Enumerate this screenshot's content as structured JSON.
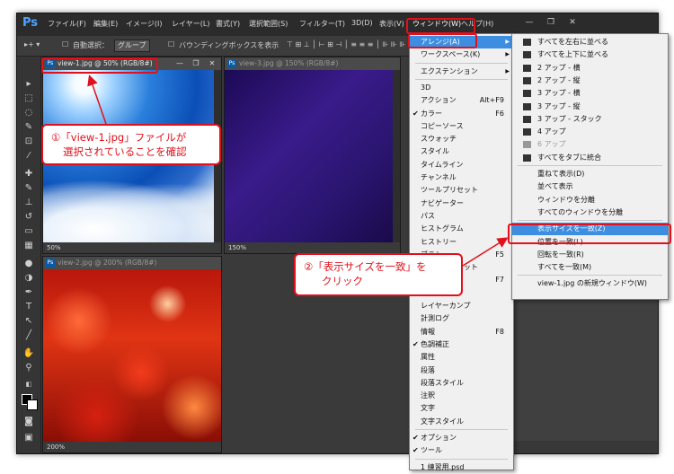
{
  "app": {
    "logo": "Ps",
    "menus": [
      "ファイル(F)",
      "編集(E)",
      "イメージ(I)",
      "レイヤー(L)",
      "書式(Y)",
      "選択範囲(S)",
      "フィルター(T)",
      "3D(D)",
      "表示(V)",
      "ウィンドウ(W)",
      "ヘルプ(H)"
    ],
    "window_controls": [
      "—",
      "❐",
      "✕"
    ]
  },
  "options_bar": {
    "auto_select_label": "自動選択：",
    "auto_select_value": "グループ",
    "bounding_box_label": "バウンディングボックスを表示"
  },
  "documents": [
    {
      "title": "view-1.jpg @ 50% (RGB/8#)",
      "zoom": "50%"
    },
    {
      "title": "view-3.jpg @ 150% (RGB/8#)",
      "zoom": "150%"
    },
    {
      "title": "view-2.jpg @ 200% (RGB/8#)",
      "zoom": "200%"
    }
  ],
  "window_menu": {
    "items": [
      {
        "label": "アレンジ(A)",
        "submenu": true,
        "highlighted": true
      },
      {
        "label": "ワークスペース(K)",
        "submenu": true
      },
      {
        "sep": true
      },
      {
        "label": "エクステンション",
        "submenu": true
      },
      {
        "sep": true
      },
      {
        "label": "3D"
      },
      {
        "label": "アクション",
        "shortcut": "Alt+F9"
      },
      {
        "label": "カラー",
        "shortcut": "F6",
        "checked": true
      },
      {
        "label": "コピーソース"
      },
      {
        "label": "スウォッチ"
      },
      {
        "label": "スタイル"
      },
      {
        "label": "タイムライン"
      },
      {
        "label": "チャンネル"
      },
      {
        "label": "ツールプリセット"
      },
      {
        "label": "ナビゲーター"
      },
      {
        "label": "パス"
      },
      {
        "label": "ヒストグラム"
      },
      {
        "label": "ヒストリー"
      },
      {
        "label": "ブラシ",
        "shortcut": "F5"
      },
      {
        "label": "ブラシプリセット"
      },
      {
        "label": "プロパティ",
        "shortcut": "F7"
      },
      {
        "label": "レイヤー"
      },
      {
        "label": "レイヤーカンプ"
      },
      {
        "label": "計測ログ"
      },
      {
        "label": "情報",
        "shortcut": "F8"
      },
      {
        "label": "色調補正",
        "checked": true
      },
      {
        "label": "属性"
      },
      {
        "label": "段落"
      },
      {
        "label": "段落スタイル"
      },
      {
        "label": "注釈"
      },
      {
        "label": "文字"
      },
      {
        "label": "文字スタイル"
      },
      {
        "sep": true
      },
      {
        "label": "オプション",
        "checked": true
      },
      {
        "label": "ツール",
        "checked": true
      },
      {
        "sep": true
      },
      {
        "label": "1 練習用.psd"
      }
    ]
  },
  "arrange_submenu": {
    "items": [
      {
        "label": "すべてを左右に並べる",
        "icon": true
      },
      {
        "label": "すべてを上下に並べる",
        "icon": true
      },
      {
        "label": "2 アップ - 横",
        "icon": true
      },
      {
        "label": "2 アップ - 縦",
        "icon": true
      },
      {
        "label": "3 アップ - 横",
        "icon": true
      },
      {
        "label": "3 アップ - 縦",
        "icon": true
      },
      {
        "label": "3 アップ - スタック",
        "icon": true
      },
      {
        "label": "4 アップ",
        "icon": true
      },
      {
        "label": "6 アップ",
        "icon": true,
        "disabled": true
      },
      {
        "label": "すべてをタブに統合",
        "icon": true
      },
      {
        "sep": true
      },
      {
        "label": "重ねて表示(D)"
      },
      {
        "label": "並べて表示"
      },
      {
        "label": "ウィンドウを分離"
      },
      {
        "label": "すべてのウィンドウを分離"
      },
      {
        "sep": true
      },
      {
        "label": "表示サイズを一致(Z)",
        "highlighted": true
      },
      {
        "label": "位置を一致(L)"
      },
      {
        "label": "回転を一致(R)"
      },
      {
        "label": "すべてを一致(M)"
      },
      {
        "sep": true
      },
      {
        "label": "view-1.jpg の新規ウィンドウ(W)"
      }
    ]
  },
  "callouts": {
    "callout1": [
      "①「view-1.jpg」ファイルが",
      "選択されていることを確認"
    ],
    "callout2": [
      "②「表示サイズを一致」を",
      "クリック"
    ]
  },
  "colors": {
    "accent": "#3d8ee0",
    "annotation": "#e0101c"
  }
}
